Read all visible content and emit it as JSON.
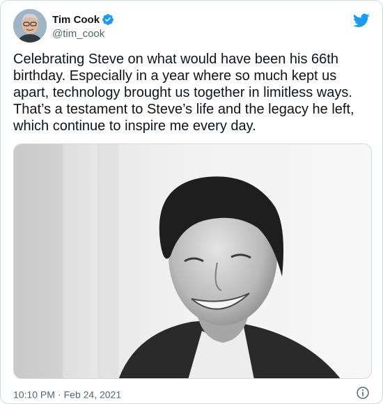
{
  "author": {
    "name": "Tim Cook",
    "handle": "@tim_cook",
    "verified": true
  },
  "tweet": {
    "text": "Celebrating Steve on what would have been his 66th birthday. Especially in a year where so much kept us apart, technology brought us together in limitless ways. That’s a testament to Steve’s life and the legacy he left, which continue to inspire me every day.",
    "time": "10:10 PM",
    "separator": "·",
    "date": "Feb 24, 2021"
  },
  "icons": {
    "brand": "twitter-bird-icon",
    "verified": "verified-badge-icon",
    "info": "info-icon"
  },
  "colors": {
    "brand": "#1d9bf0",
    "text": "#0f1419",
    "muted": "#536471",
    "border": "#cfd9de"
  }
}
